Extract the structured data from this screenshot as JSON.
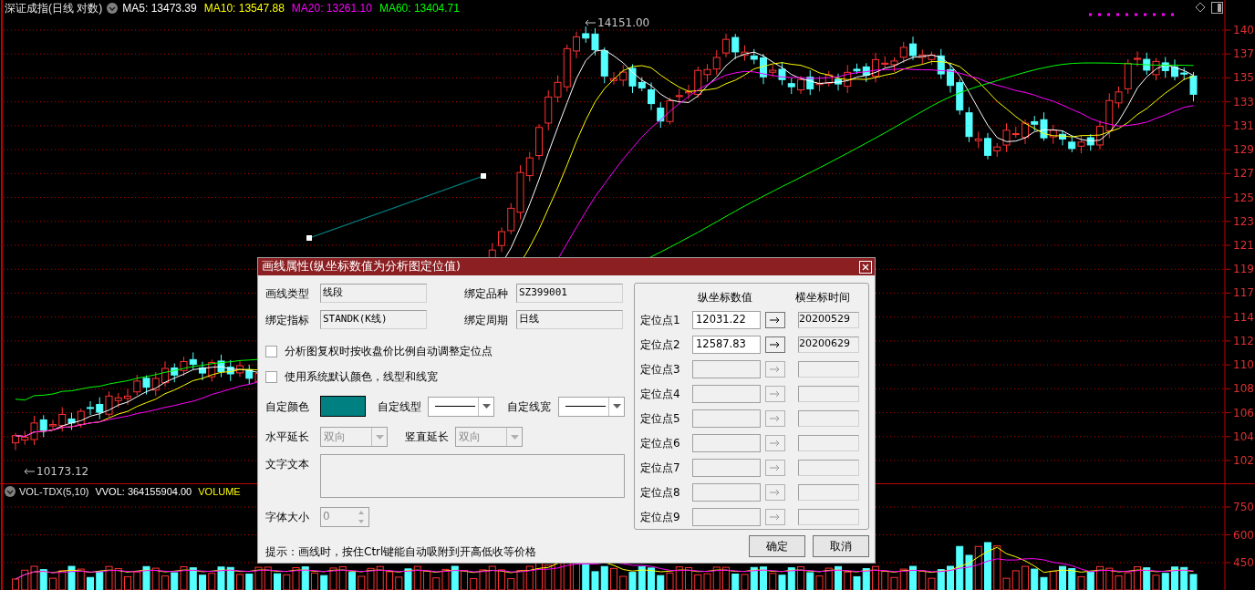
{
  "chart_header": {
    "title": "深证成指(日线 对数)",
    "indicators": [
      {
        "label": "MA5: 13473.39",
        "color": "#ffffff"
      },
      {
        "label": "MA10: 13547.88",
        "color": "#ffff00"
      },
      {
        "label": "MA20: 13261.10",
        "color": "#ff00ff"
      },
      {
        "label": "MA60: 13404.71",
        "color": "#00ff00"
      }
    ]
  },
  "price_marks": {
    "high": "14151.00",
    "low": "10173.12"
  },
  "price_axis": {
    "labels": [
      "140",
      "137",
      "135",
      "133",
      "131",
      "129",
      "127",
      "125",
      "123",
      "121",
      "119",
      "117",
      "114",
      "112",
      "110",
      "108",
      "106",
      "104",
      "102"
    ]
  },
  "volume_header": {
    "title": "VOL-TDX(5,10)",
    "indicators": [
      {
        "label": "VVOL: 364155904.00",
        "color": "#ffffff"
      },
      {
        "label": "VOLUME",
        "color": "#ffff00"
      }
    ]
  },
  "volume_axis": {
    "labels": [
      "750",
      "600",
      "450"
    ]
  },
  "dialog": {
    "title": "画线属性(纵坐标数值为分析图定位值)",
    "info_fields": [
      {
        "label": "画线类型",
        "value": "线段"
      },
      {
        "label": "绑定品种",
        "value": "SZ399001"
      },
      {
        "label": "绑定指标",
        "value": "STANDK(K线)"
      },
      {
        "label": "绑定周期",
        "value": "日线"
      }
    ],
    "checkboxes": [
      {
        "label": "分析图复权时按收盘价比例自动调整定位点",
        "checked": false
      },
      {
        "label": "使用系统默认颜色，线型和线宽",
        "checked": false
      }
    ],
    "color_label": "自定颜色",
    "color": "#008080",
    "line_style_label": "自定线型",
    "line_width_label": "自定线宽",
    "extends": [
      {
        "label": "水平延长",
        "value": "双向",
        "disabled": true
      },
      {
        "label": "竖直延长",
        "value": "双向",
        "disabled": true
      }
    ],
    "text_label": "文字文本",
    "font_size": {
      "label": "字体大小",
      "value": "0"
    },
    "hint": "提示：画线时，按住Ctrl键能自动吸附到开高低收等价格",
    "points_header": [
      "纵坐标数值",
      "横坐标时间"
    ],
    "points": [
      {
        "label": "定位点1",
        "value": "12031.22",
        "time": "20200529",
        "disabled": false
      },
      {
        "label": "定位点2",
        "value": "12587.83",
        "time": "20200629",
        "disabled": false
      },
      {
        "label": "定位点3",
        "disabled": true
      },
      {
        "label": "定位点4",
        "disabled": true
      },
      {
        "label": "定位点5",
        "disabled": true
      },
      {
        "label": "定位点6",
        "disabled": true
      },
      {
        "label": "定位点7",
        "disabled": true
      },
      {
        "label": "定位点8",
        "disabled": true
      },
      {
        "label": "定位点9",
        "disabled": true
      }
    ],
    "buttons": [
      "确定",
      "取消"
    ]
  }
}
